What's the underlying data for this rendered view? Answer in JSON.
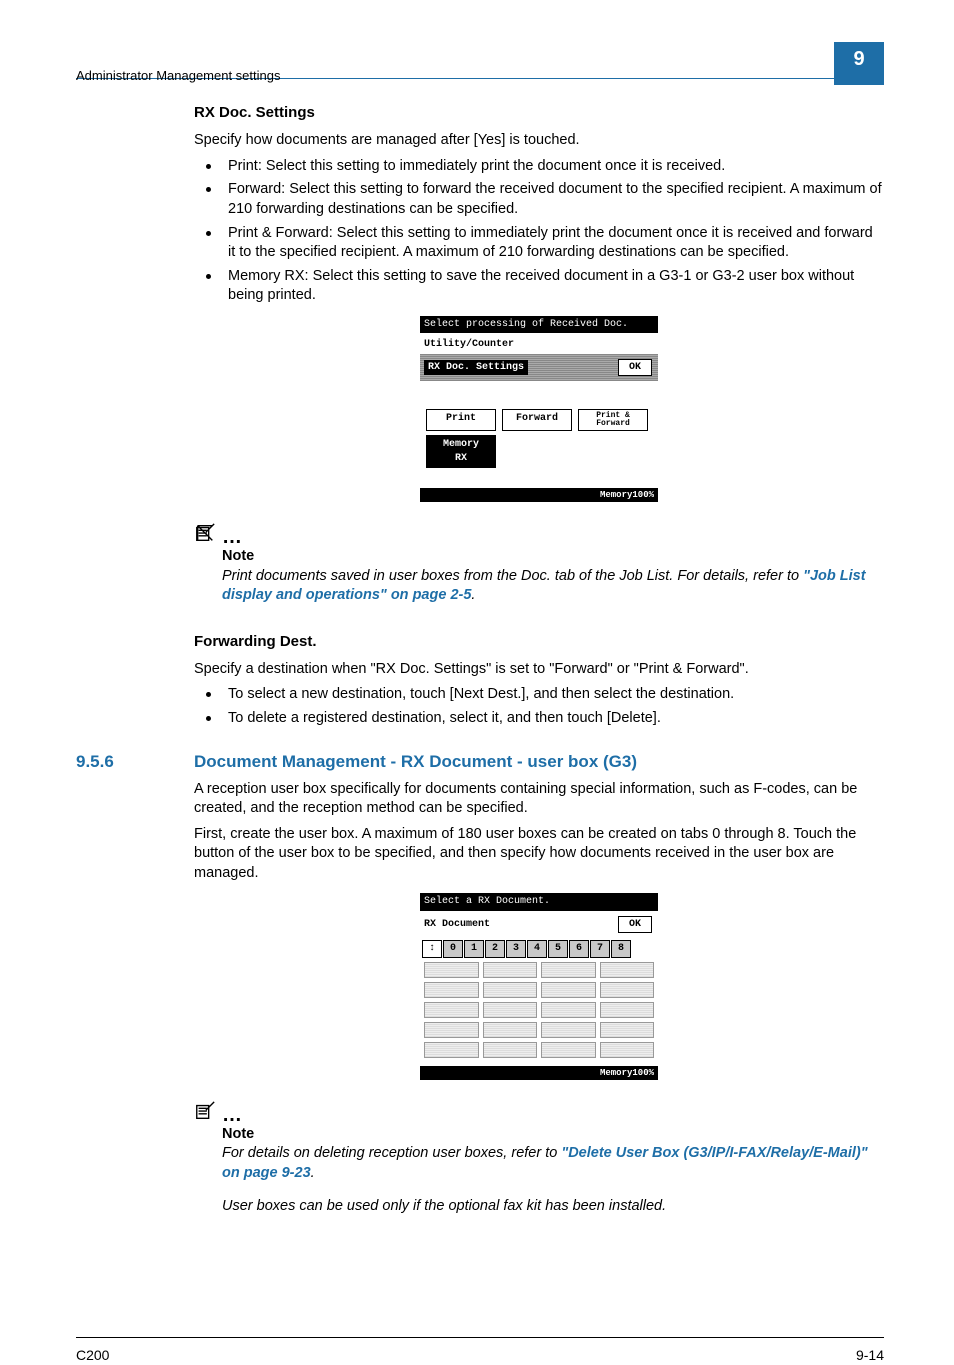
{
  "header": {
    "left": "Administrator Management settings",
    "chapter": "9"
  },
  "rx_doc": {
    "title": "RX Doc. Settings",
    "intro": "Specify how documents are managed after [Yes] is touched.",
    "bullets": [
      "Print: Select this setting to immediately print the document once it is received.",
      "Forward: Select this setting to forward the received document to the specified recipient. A maximum of 210 forwarding destinations can be specified.",
      "Print & Forward: Select this setting to immediately print the document once it is received and forward it to the specified recipient. A maximum of 210 forwarding destinations can be specified.",
      "Memory RX: Select this setting to save the received document in a G3-1 or G3-2 user box without being printed."
    ],
    "fig1": {
      "top": "Select processing of Received Doc.",
      "util": "Utility/Counter",
      "bar_title": "RX Doc. Settings",
      "ok": "OK",
      "buttons": [
        "Print",
        "Forward",
        "Print &\nForward"
      ],
      "mem_btn": "Memory RX",
      "footer": "Memory100%"
    }
  },
  "note1": {
    "label": "Note",
    "body_pre": "Print documents saved in user boxes from the Doc. tab of the Job List. For details, refer to ",
    "link": "\"Job List display and operations\" on page 2-5",
    "body_post": "."
  },
  "fwd": {
    "title": "Forwarding Dest.",
    "intro": "Specify a destination when \"RX Doc. Settings\" is set to \"Forward\" or \"Print & Forward\".",
    "bullets": [
      "To select a new destination, touch [Next Dest.], and then select the destination.",
      "To delete a registered destination, select it, and then touch [Delete]."
    ]
  },
  "section": {
    "num": "9.5.6",
    "title": "Document Management - RX Document - user box (G3)",
    "p1": "A reception user box specifically for documents containing special information, such as F-codes, can be created, and the reception method can be specified.",
    "p2": "First, create the user box. A maximum of 180 user boxes can be created on tabs 0 through 8. Touch the button of the user box to be specified, and then specify how documents received in the user box are managed.",
    "fig2": {
      "top": "Select a RX Document.",
      "title": "RX Document",
      "ok": "OK",
      "tabs": [
        "↕",
        "0",
        "1",
        "2",
        "3",
        "4",
        "5",
        "6",
        "7",
        "8"
      ],
      "footer": "Memory100%"
    }
  },
  "note2": {
    "label": "Note",
    "body_pre": "For details on deleting reception user boxes, refer to ",
    "link": "\"Delete User Box (G3/IP/I-FAX/Relay/E-Mail)\" on page 9-23",
    "body_post": ".",
    "p2": "User boxes can be used only if the optional fax kit has been installed."
  },
  "footer": {
    "left": "C200",
    "right": "9-14"
  }
}
